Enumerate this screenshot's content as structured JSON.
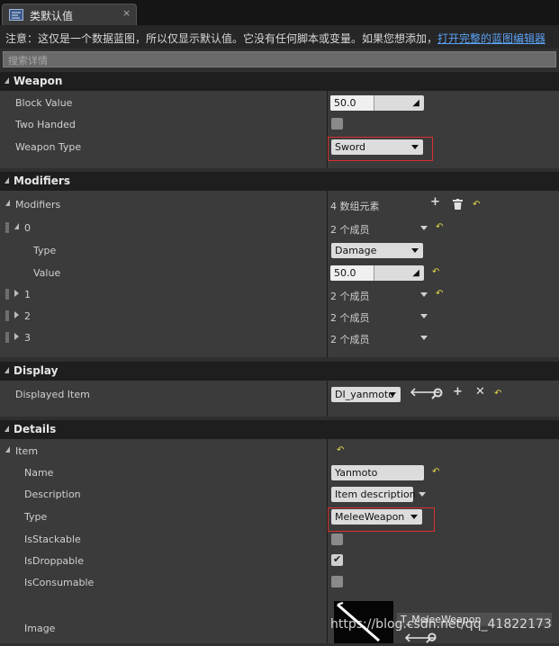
{
  "tab": {
    "title": "类默认值",
    "close": "×",
    "icon": "blueprint-icon"
  },
  "notice": {
    "text": "注意：这仅是一个数据蓝图，所以仅显示默认值。它没有任何脚本或变量。如果您想添加，",
    "link": "打开完整的蓝图编辑器"
  },
  "search": {
    "placeholder": "搜索详情"
  },
  "weapon": {
    "title": "Weapon",
    "block_value_label": "Block Value",
    "block_value": "50.0",
    "two_handed_label": "Two Handed",
    "two_handed": false,
    "weapon_type_label": "Weapon Type",
    "weapon_type": "Sword"
  },
  "modifiers": {
    "title": "Modifiers",
    "array_label": "Modifiers",
    "array_count": "4 数组元素",
    "items": [
      {
        "index": "0",
        "members": "2 个成员",
        "expanded": true
      },
      {
        "index": "1",
        "members": "2 个成员",
        "expanded": false
      },
      {
        "index": "2",
        "members": "2 个成员",
        "expanded": false
      },
      {
        "index": "3",
        "members": "2 个成员",
        "expanded": false
      }
    ],
    "type_label": "Type",
    "type_value": "Damage",
    "value_label": "Value",
    "value_value": "50.0"
  },
  "display": {
    "title": "Display",
    "displayed_item_label": "Displayed Item",
    "displayed_item": "DI_yanmoto"
  },
  "details": {
    "title": "Details",
    "item_label": "Item",
    "name_label": "Name",
    "name": "Yanmoto",
    "description_label": "Description",
    "description": "Item description",
    "type_label": "Type",
    "type": "MeleeWeapon",
    "stackable_label": "IsStackable",
    "stackable": false,
    "droppable_label": "IsDroppable",
    "droppable": true,
    "consumable_label": "IsConsumable",
    "consumable": false,
    "image_label": "Image",
    "image_asset": "T_MeleeWeapon"
  },
  "watermark": "https://blog.csdn.net/qq_41822173",
  "colors": {
    "highlight": "#d83030",
    "link": "#5ba0f2",
    "reset": "#e4d84a"
  }
}
